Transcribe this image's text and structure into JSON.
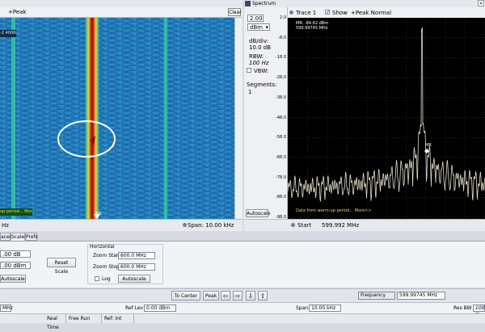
{
  "spectrogram": {
    "peak_label": "+Peak",
    "clear_label": "Clear",
    "readout": "-2.400689",
    "warm_msg": "up period... More>>",
    "marker_label": "MR",
    "status_left": "Hz",
    "status_span": "Span: 10.00 kHz"
  },
  "spectrum": {
    "title": "Spectrum",
    "close_icon": "×",
    "ref_value": "2.00",
    "ref_unit": "dBm",
    "db_div_label": "dB/div:",
    "db_div_value": "10.0 dB",
    "rbw_label": "RBW:",
    "rbw_value": "100 Hz",
    "vbw_label": "VBW:",
    "segments_label": "Segments:",
    "segments_value": "1",
    "autoscale_label": "Autoscale",
    "trace_label": "Trace 1",
    "show_label": "Show",
    "trace_type": "+Peak Normal",
    "marker_readout_1": "MR: -84.62 dBm",
    "marker_readout_2": "599.99745 MHz",
    "marker_label": "MR",
    "warm_msg": "Data from warm-up period... More>>",
    "start_label": "Start",
    "start_value": "599.992 MHz",
    "y_ticks": [
      "2.0",
      "-8.0",
      "-18.0",
      "-28.0",
      "-38.0",
      "-48.0",
      "-58.0",
      "-68.0",
      "-78.0",
      "-88.0",
      "-98.0"
    ]
  },
  "tabs": [
    "aces",
    "Scale",
    "Prefs"
  ],
  "scale": {
    "field1": ".00 dB",
    "field2": ".00 dBm",
    "autoscale_label": "Autoscale",
    "reset_label": "Reset Scale",
    "horizontal_label": "Horizontal",
    "zoom_start_label": "Zoom Start:",
    "zoom_start_value": "600.0 MHz",
    "zoom_stop_label": "Zoom Stop:",
    "zoom_stop_value": "600.0 MHz",
    "log_label": "Log",
    "h_autoscale_label": "Autoscale"
  },
  "toolbar": {
    "to_center_label": "To Center",
    "peak_label": "Peak",
    "left_icon": "⇦",
    "right_icon": "⇨",
    "down_icon": "⇩",
    "up_icon": "⇧",
    "freq_label": "Frequency",
    "freq_value": "599.99745 MHz"
  },
  "measbar": {
    "left_value": "MHz",
    "ref_lev_label": "Ref Lev",
    "ref_lev_value": "0.00 dBm",
    "span_label": "Span",
    "span_value": "10.00 kHz",
    "res_bw_label": "Res BW",
    "res_bw_value": "100 H"
  },
  "statusbar": {
    "real_time": "Real Time",
    "free_run": "Free Run",
    "ref_int": "Ref: Int"
  },
  "colors": {
    "spectrogram_bg": "#1f74b8",
    "trace": "#dcd9c4",
    "grid": "#555555"
  }
}
